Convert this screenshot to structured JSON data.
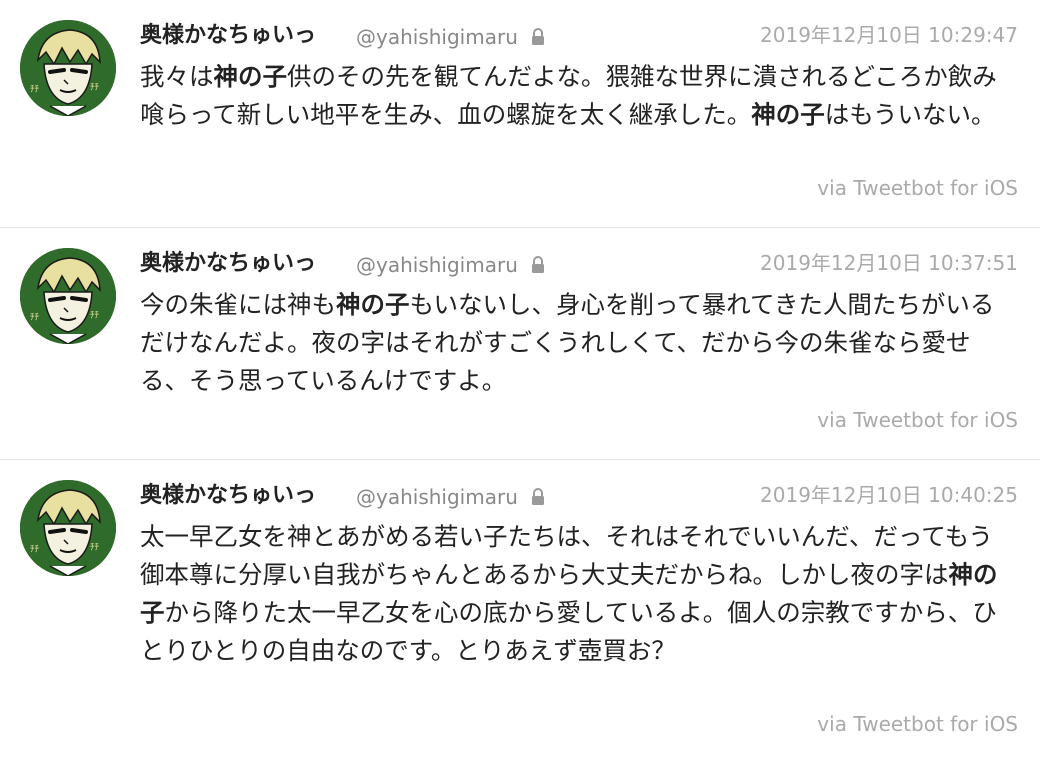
{
  "accent_colors": {
    "avatar_green": "#2f6b2a",
    "meta_gray": "#aaaaaa",
    "handle_gray": "#888888",
    "divider": "#e6e6e6"
  },
  "tweets": [
    {
      "author_name": "奥様かなちゅいっ",
      "handle": "@yahishigimaru",
      "lock_icon": "lock-icon",
      "timestamp": "2019年12月10日 10:29:47",
      "segments": [
        {
          "text": "我々は",
          "bold": false
        },
        {
          "text": "神の子",
          "bold": true
        },
        {
          "text": "供のその先を観てんだよな。猥雑な世界に潰されるどころか飲み喰らって新しい地平を生み、血の螺旋を太く継承した。",
          "bold": false
        },
        {
          "text": "神の子",
          "bold": true
        },
        {
          "text": "はもういない。",
          "bold": false
        }
      ],
      "via": "via Tweetbot for iOS"
    },
    {
      "author_name": "奥様かなちゅいっ",
      "handle": "@yahishigimaru",
      "lock_icon": "lock-icon",
      "timestamp": "2019年12月10日 10:37:51",
      "segments": [
        {
          "text": "今の朱雀には神も",
          "bold": false
        },
        {
          "text": "神の子",
          "bold": true
        },
        {
          "text": "もいないし、身心を削って暴れてきた人間たちがいるだけなんだよ。夜の字はそれがすごくうれしくて、だから今の朱雀なら愛せる、そう思っているんけですよ。",
          "bold": false
        }
      ],
      "via": "via Tweetbot for iOS"
    },
    {
      "author_name": "奥様かなちゅいっ",
      "handle": "@yahishigimaru",
      "lock_icon": "lock-icon",
      "timestamp": "2019年12月10日 10:40:25",
      "segments": [
        {
          "text": "太一早乙女を神とあがめる若い子たちは、それはそれでいいんだ、だってもう御本尊に分厚い自我がちゃんとあるから大丈夫だからね。しかし夜の字は",
          "bold": false
        },
        {
          "text": "神の子",
          "bold": true
        },
        {
          "text": "から降りた太一早乙女を心の底から愛しているよ。個人の宗教ですから、ひとりひとりの自由なのです。とりあえず壺買お？",
          "bold": false
        }
      ],
      "via": "via Tweetbot for iOS"
    }
  ]
}
